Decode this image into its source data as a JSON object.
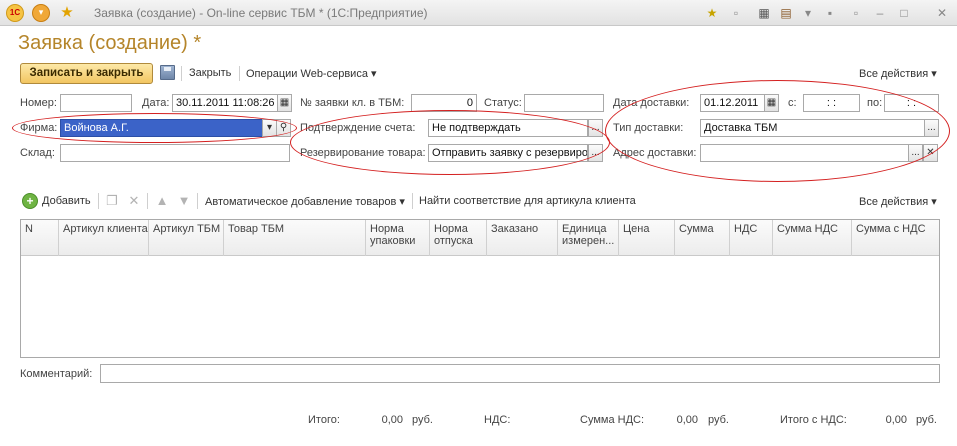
{
  "window": {
    "title": "Заявка (создание) - On-line сервис ТБМ * (1С:Предприятие)",
    "logo_text": "1C"
  },
  "form": {
    "heading": "Заявка (создание) *"
  },
  "toolbar": {
    "save_close": "Записать и закрыть",
    "close": "Закрыть",
    "web_ops": "Операции Web-сервиса",
    "all_actions": "Все действия"
  },
  "fields": {
    "number_label": "Номер:",
    "number_value": "",
    "date_label": "Дата:",
    "date_value": "30.11.2011 11:08:26",
    "tbm_no_label": "№ заявки кл. в ТБМ:",
    "tbm_no_value": "0",
    "status_label": "Статус:",
    "status_value": "",
    "delivery_date_label": "Дата доставки:",
    "delivery_date_value": "01.12.2011",
    "from_label": "с:",
    "from_value": ": :",
    "to_label": "по:",
    "to_value": ": :",
    "firm_label": "Фирма:",
    "firm_value": "Войнова А.Г.",
    "invoice_confirm_label": "Подтверждение счета:",
    "invoice_confirm_value": "Не подтверждать",
    "delivery_type_label": "Тип доставки:",
    "delivery_type_value": "Доставка ТБМ",
    "warehouse_label": "Склад:",
    "warehouse_value": "",
    "reserve_label": "Резервирование товара:",
    "reserve_value": "Отправить заявку с резервиро",
    "delivery_addr_label": "Адрес доставки:",
    "delivery_addr_value": ""
  },
  "table_toolbar": {
    "add": "Добавить",
    "auto_add": "Автоматическое добавление товаров",
    "find_match": "Найти соответствие для артикула клиента",
    "all_actions": "Все действия"
  },
  "table": {
    "columns": [
      "N",
      "Артикул клиента",
      "Артикул ТБМ",
      "Товар ТБМ",
      "Норма упаковки",
      "Норма отпуска",
      "Заказано",
      "Единица измерен...",
      "Цена",
      "Сумма",
      "НДС",
      "Сумма НДС",
      "Сумма с НДС"
    ]
  },
  "comment": {
    "label": "Комментарий:",
    "value": ""
  },
  "totals": {
    "total_label": "Итого:",
    "total_value": "0,00",
    "currency1": "руб.",
    "vat_label": "НДС:",
    "vat_sum_label": "Сумма НДС:",
    "vat_sum_value": "0,00",
    "currency2": "руб.",
    "total_vat_label": "Итого с НДС:",
    "total_vat_value": "0,00",
    "currency3": "руб."
  },
  "icons": {
    "dropdown_arrow": "▾",
    "search_icon": "magnifier",
    "dots": "...",
    "clear": "✕",
    "calendar": "calendar-icon"
  },
  "colors": {
    "heading": "#b5852a",
    "annotation": "#d42020",
    "selection": "#3b63c8"
  }
}
